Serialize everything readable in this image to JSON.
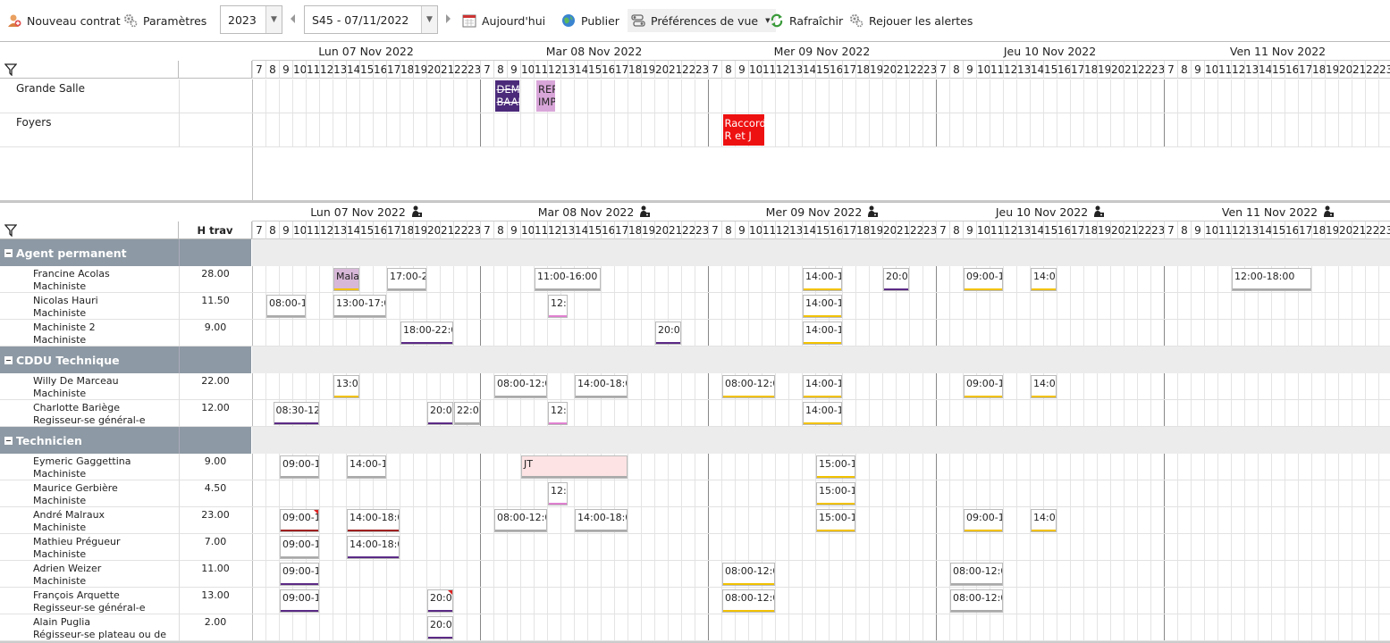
{
  "toolbar": {
    "new_contract": "Nouveau contrat",
    "settings": "Paramètres",
    "year": "2023",
    "week": "S45 - 07/11/2022",
    "today": "Aujourd'hui",
    "publish": "Publier",
    "view_prefs": "Préférences de vue",
    "refresh": "Rafraîchir",
    "replay_alerts": "Rejouer les alertes"
  },
  "days": [
    "Lun 07 Nov 2022",
    "Mar 08 Nov 2022",
    "Mer 09 Nov 2022",
    "Jeu 10 Nov 2022",
    "Ven 11 Nov 2022"
  ],
  "hours": [
    "7",
    "8",
    "9",
    "10",
    "11",
    "12",
    "13",
    "14",
    "15",
    "16",
    "17",
    "18",
    "19",
    "20",
    "21",
    "22",
    "23"
  ],
  "rooms": [
    {
      "name": "Grande Salle",
      "events": [
        {
          "day": 1,
          "start": 8.1,
          "end": 9.9,
          "lines": [
            "DEMO",
            "BAAL"
          ],
          "color": "#4b2a7a",
          "text": "#ffffff",
          "strike": true
        },
        {
          "day": 1,
          "start": 11.2,
          "end": 12.6,
          "lines": [
            "REP",
            "IMP"
          ],
          "color": "#d9a6d9",
          "text": "#222222"
        }
      ]
    },
    {
      "name": "Foyers",
      "events": [
        {
          "day": 2,
          "start": 8.1,
          "end": 11.2,
          "lines": [
            "Raccord",
            "R et J"
          ],
          "color": "#ee1111",
          "text": "#ffffff"
        }
      ]
    }
  ],
  "staff_header": {
    "hours_label": "H trav"
  },
  "groups": [
    {
      "name": "Agent permanent",
      "people": [
        {
          "name": "Francine Acolas",
          "role": "Machiniste",
          "hours": "28.00",
          "events": [
            {
              "day": 0,
              "start": 13,
              "end": 15,
              "label": "Malac",
              "bar": "#f2c200",
              "fill": "#d8b8d8"
            },
            {
              "day": 0,
              "start": 17,
              "end": 20,
              "label": "17:00-20",
              "bar": "#aaaaaa"
            },
            {
              "day": 1,
              "start": 11,
              "end": 16,
              "label": "11:00-16:00",
              "bar": "#aaaaaa"
            },
            {
              "day": 2,
              "start": 14,
              "end": 17,
              "label": "14:00-17",
              "bar": "#f2c200"
            },
            {
              "day": 2,
              "start": 20,
              "end": 22,
              "label": "20:00",
              "bar": "#5b2a86"
            },
            {
              "day": 3,
              "start": 9,
              "end": 12,
              "label": "09:00-12",
              "bar": "#f2c200"
            },
            {
              "day": 3,
              "start": 14,
              "end": 16,
              "label": "14:00",
              "bar": "#f2c200"
            },
            {
              "day": 4,
              "start": 12,
              "end": 18,
              "label": "12:00-18:00",
              "bar": "#aaaaaa"
            }
          ]
        },
        {
          "name": "Nicolas Hauri",
          "role": "Machiniste",
          "hours": "11.50",
          "events": [
            {
              "day": 0,
              "start": 8,
              "end": 11,
              "label": "08:00-11",
              "bar": "#aaaaaa"
            },
            {
              "day": 0,
              "start": 13,
              "end": 17,
              "label": "13:00-17:00",
              "bar": "#aaaaaa"
            },
            {
              "day": 1,
              "start": 12,
              "end": 13.5,
              "label": "12:1",
              "bar": "#e080d0"
            },
            {
              "day": 2,
              "start": 14,
              "end": 17,
              "label": "14:00-17",
              "bar": "#f2c200"
            }
          ]
        },
        {
          "name": "Machiniste 2",
          "role": "Machiniste",
          "hours": "9.00",
          "events": [
            {
              "day": 0,
              "start": 18,
              "end": 22,
              "label": "18:00-22:00",
              "bar": "#5b2a86"
            },
            {
              "day": 1,
              "start": 20,
              "end": 22,
              "label": "20:00",
              "bar": "#5b2a86"
            },
            {
              "day": 2,
              "start": 14,
              "end": 17,
              "label": "14:00-17",
              "bar": "#f2c200"
            }
          ]
        }
      ]
    },
    {
      "name": "CDDU Technique",
      "people": [
        {
          "name": "Willy De Marceau",
          "role": "Machiniste",
          "hours": "22.00",
          "events": [
            {
              "day": 0,
              "start": 13,
              "end": 15,
              "label": "13:00",
              "bar": "#f2c200"
            },
            {
              "day": 1,
              "start": 8,
              "end": 12,
              "label": "08:00-12:00",
              "bar": "#aaaaaa"
            },
            {
              "day": 1,
              "start": 14,
              "end": 18,
              "label": "14:00-18:00",
              "bar": "#aaaaaa"
            },
            {
              "day": 2,
              "start": 8,
              "end": 12,
              "label": "08:00-12:00",
              "bar": "#f2c200"
            },
            {
              "day": 2,
              "start": 14,
              "end": 17,
              "label": "14:00-17",
              "bar": "#f2c200"
            },
            {
              "day": 3,
              "start": 9,
              "end": 12,
              "label": "09:00-12",
              "bar": "#f2c200"
            },
            {
              "day": 3,
              "start": 14,
              "end": 16,
              "label": "14:00",
              "bar": "#f2c200"
            }
          ]
        },
        {
          "name": "Charlotte Bariège",
          "role": "Regisseur-se général-e",
          "hours": "12.00",
          "events": [
            {
              "day": 0,
              "start": 8.5,
              "end": 12,
              "label": "08:30-12:0",
              "bar": "#5b2a86"
            },
            {
              "day": 0,
              "start": 20,
              "end": 22,
              "label": "20:00",
              "bar": "#5b2a86"
            },
            {
              "day": 0,
              "start": 22,
              "end": 24,
              "label": "22:00",
              "bar": "#aaaaaa"
            },
            {
              "day": 1,
              "start": 12,
              "end": 13.5,
              "label": "12:1",
              "bar": "#e080d0"
            },
            {
              "day": 2,
              "start": 14,
              "end": 17,
              "label": "14:00-17",
              "bar": "#f2c200"
            }
          ]
        }
      ]
    },
    {
      "name": "Technicien",
      "people": [
        {
          "name": "Eymeric Gaggettina",
          "role": "Machiniste",
          "hours": "9.00",
          "events": [
            {
              "day": 0,
              "start": 9,
              "end": 12,
              "label": "09:00-12",
              "bar": "#aaaaaa"
            },
            {
              "day": 0,
              "start": 14,
              "end": 17,
              "label": "14:00-17",
              "bar": "#aaaaaa"
            },
            {
              "day": 1,
              "start": 10,
              "end": 18,
              "label": "JT",
              "bar": "#aaaaaa",
              "fill": "#fde3e3"
            },
            {
              "day": 2,
              "start": 15,
              "end": 18,
              "label": "15:00-18",
              "bar": "#f2c200"
            }
          ]
        },
        {
          "name": "Maurice Gerbière",
          "role": "Machiniste",
          "hours": "4.50",
          "events": [
            {
              "day": 1,
              "start": 12,
              "end": 13.5,
              "label": "12:1",
              "bar": "#e080d0"
            },
            {
              "day": 2,
              "start": 15,
              "end": 18,
              "label": "15:00-18",
              "bar": "#f2c200"
            }
          ]
        },
        {
          "name": "André Malraux",
          "role": "Machiniste",
          "hours": "23.00",
          "events": [
            {
              "day": 0,
              "start": 9,
              "end": 12,
              "label": "09:00-12",
              "bar": "#a02020",
              "alert": true
            },
            {
              "day": 0,
              "start": 14,
              "end": 18,
              "label": "14:00-18:00",
              "bar": "#a02020"
            },
            {
              "day": 1,
              "start": 8,
              "end": 12,
              "label": "08:00-12:00",
              "bar": "#aaaaaa"
            },
            {
              "day": 1,
              "start": 14,
              "end": 18,
              "label": "14:00-18:00",
              "bar": "#aaaaaa"
            },
            {
              "day": 2,
              "start": 15,
              "end": 18,
              "label": "15:00-18",
              "bar": "#f2c200"
            },
            {
              "day": 3,
              "start": 9,
              "end": 12,
              "label": "09:00-12",
              "bar": "#f2c200"
            },
            {
              "day": 3,
              "start": 14,
              "end": 16,
              "label": "14:00",
              "bar": "#f2c200"
            }
          ]
        },
        {
          "name": "Mathieu Prégueur",
          "role": "Machiniste",
          "hours": "7.00",
          "events": [
            {
              "day": 0,
              "start": 9,
              "end": 12,
              "label": "09:00-12",
              "bar": "#aaaaaa"
            },
            {
              "day": 0,
              "start": 14,
              "end": 18,
              "label": "14:00-18:00",
              "bar": "#5b2a86"
            }
          ]
        },
        {
          "name": "Adrien Weizer",
          "role": "Machiniste",
          "hours": "11.00",
          "events": [
            {
              "day": 0,
              "start": 9,
              "end": 12,
              "label": "09:00-12",
              "bar": "#5b2a86"
            },
            {
              "day": 2,
              "start": 8,
              "end": 12,
              "label": "08:00-12:00",
              "bar": "#f2c200"
            },
            {
              "day": 3,
              "start": 8,
              "end": 12,
              "label": "08:00-12:00",
              "bar": "#aaaaaa"
            }
          ]
        },
        {
          "name": "François Arquette",
          "role": "Regisseur-se général-e",
          "hours": "13.00",
          "events": [
            {
              "day": 0,
              "start": 9,
              "end": 12,
              "label": "09:00-12",
              "bar": "#5b2a86"
            },
            {
              "day": 0,
              "start": 20,
              "end": 22,
              "label": "20:00",
              "bar": "#5b2a86",
              "alert": true
            },
            {
              "day": 2,
              "start": 8,
              "end": 12,
              "label": "08:00-12:00",
              "bar": "#f2c200"
            },
            {
              "day": 3,
              "start": 8,
              "end": 12,
              "label": "08:00-12:00",
              "bar": "#aaaaaa"
            }
          ]
        },
        {
          "name": "Alain Puglia",
          "role": "Régisseur-se plateau ou de",
          "hours": "2.00",
          "events": [
            {
              "day": 0,
              "start": 20,
              "end": 22,
              "label": "20:00",
              "bar": "#5b2a86"
            }
          ]
        }
      ]
    }
  ]
}
